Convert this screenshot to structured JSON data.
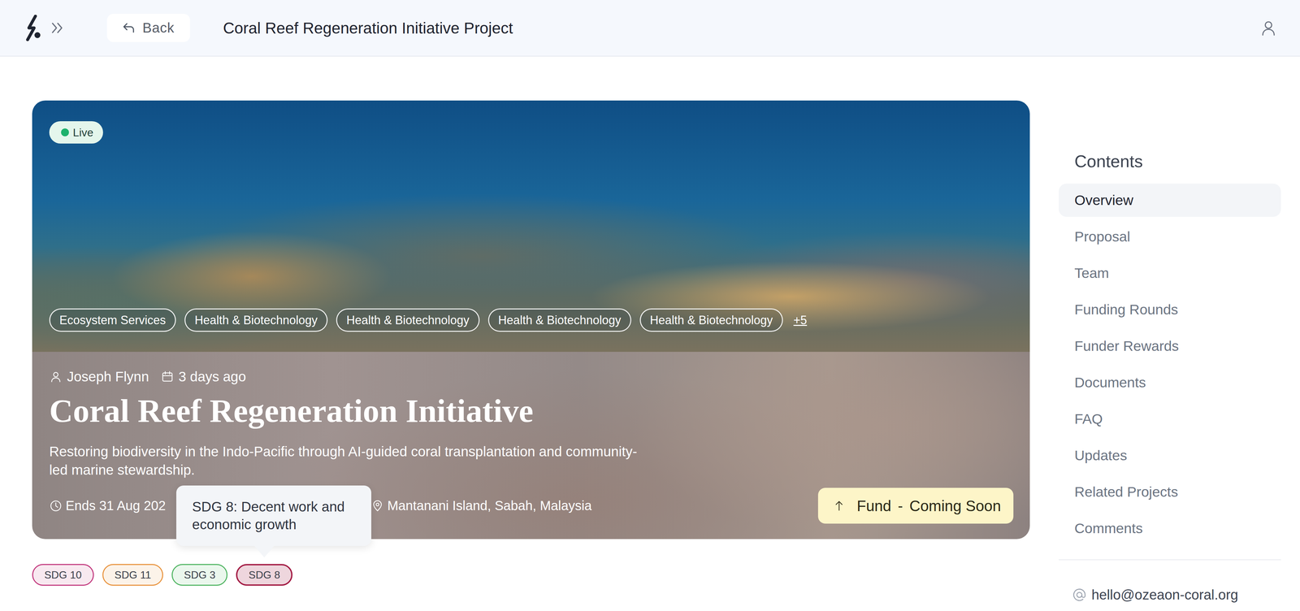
{
  "header": {
    "back_label": "Back",
    "title": "Coral Reef Regeneration Initiative Project"
  },
  "hero": {
    "status": "Live",
    "tags": [
      "Ecosystem Services",
      "Health & Biotechnology",
      "Health & Biotechnology",
      "Health & Biotechnology",
      "Health & Biotechnology"
    ],
    "more_tags": "+5",
    "author": "Joseph Flynn",
    "posted": "3 days ago",
    "title": "Coral Reef Regeneration Initiative",
    "description": "Restoring biodiversity in the Indo-Pacific through AI-guided coral transplantation and community-led marine stewardship.",
    "ends": "Ends 31 Aug 202",
    "location": "Mantanani Island, Sabah, Malaysia",
    "fund_button": {
      "label": "Fund",
      "separator": "-",
      "status": "Coming Soon"
    }
  },
  "sdgs": [
    {
      "label": "SDG 10",
      "color": "#c0337a",
      "hovered": false
    },
    {
      "label": "SDG 11",
      "color": "#e8913a",
      "hovered": false
    },
    {
      "label": "SDG 3",
      "color": "#4cb35f",
      "hovered": false
    },
    {
      "label": "SDG 8",
      "color": "#a21942",
      "hovered": true
    }
  ],
  "tooltip": {
    "text": "SDG 8: Decent work and economic growth"
  },
  "sidebar": {
    "title": "Contents",
    "items": [
      {
        "label": "Overview",
        "selected": true
      },
      {
        "label": "Proposal",
        "selected": false
      },
      {
        "label": "Team",
        "selected": false
      },
      {
        "label": "Funding Rounds",
        "selected": false
      },
      {
        "label": "Funder Rewards",
        "selected": false
      },
      {
        "label": "Documents",
        "selected": false
      },
      {
        "label": "FAQ",
        "selected": false
      },
      {
        "label": "Updates",
        "selected": false
      },
      {
        "label": "Related Projects",
        "selected": false
      },
      {
        "label": "Comments",
        "selected": false
      }
    ],
    "email": "hello@ozeaon-coral.org"
  }
}
